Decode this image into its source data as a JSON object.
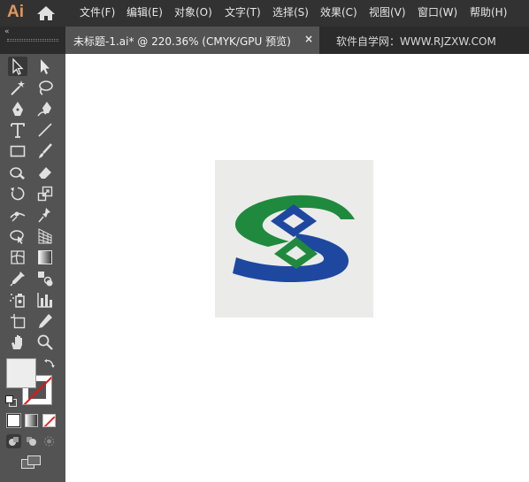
{
  "app": {
    "logo_text": "Ai"
  },
  "menu": {
    "items": [
      {
        "label": "文件(F)"
      },
      {
        "label": "编辑(E)"
      },
      {
        "label": "对象(O)"
      },
      {
        "label": "文字(T)"
      },
      {
        "label": "选择(S)"
      },
      {
        "label": "效果(C)"
      },
      {
        "label": "视图(V)"
      },
      {
        "label": "窗口(W)"
      },
      {
        "label": "帮助(H)"
      }
    ]
  },
  "tabs": {
    "collapse_glyph": "«",
    "active": {
      "title": "未标题-1.ai* @ 220.36% (CMYK/GPU 预览)",
      "close_glyph": "×"
    },
    "other": {
      "title": "软件自学网：WWW.RJZXW.COM"
    }
  },
  "toolbar": {
    "tools": [
      "selection-tool-icon",
      "direct-selection-tool-icon",
      "magic-wand-tool-icon",
      "lasso-tool-icon",
      "pen-tool-icon",
      "curvature-tool-icon",
      "type-tool-icon",
      "line-segment-tool-icon",
      "rectangle-tool-icon",
      "paintbrush-tool-icon",
      "shaper-tool-icon",
      "eraser-tool-icon",
      "rotate-tool-icon",
      "scale-tool-icon",
      "width-tool-icon",
      "puppet-warp-tool-icon",
      "shape-builder-tool-icon",
      "perspective-grid-tool-icon",
      "mesh-tool-icon",
      "gradient-tool-icon",
      "eyedropper-tool-icon",
      "blend-tool-icon",
      "symbol-sprayer-tool-icon",
      "column-graph-tool-icon",
      "artboard-tool-icon",
      "slice-tool-icon",
      "hand-tool-icon",
      "zoom-tool-icon"
    ],
    "fill_color": "#ededed",
    "stroke_color": "none"
  },
  "canvas": {
    "logo_colors": {
      "green": "#1f8a3e",
      "blue": "#1e48a0",
      "background": "#ebebe9"
    }
  },
  "colors": {
    "menubar_bg": "#323232",
    "tabstrip_bg": "#2b2b2b",
    "panel_bg": "#535353",
    "accent_orange": "#e3955b"
  }
}
